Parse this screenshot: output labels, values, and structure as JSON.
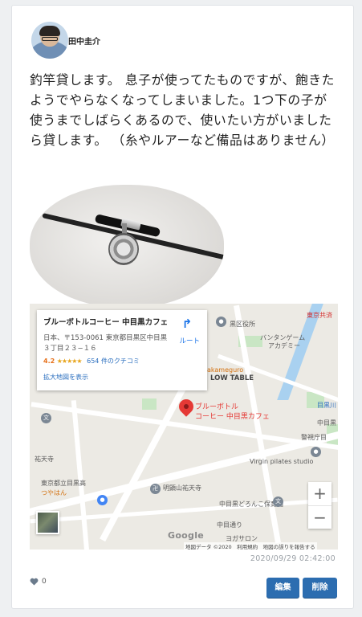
{
  "post": {
    "author": "田中圭介",
    "body": "釣竿貸します。 息子が使ってたものですが、飽きたようでやらなくなってしまいました。1つ下の子が使うまでしばらくあるので、使いたい方がいましたら貸します。 （糸やルアーなど備品はありません）",
    "timestamp": "2020/09/29 02:42:00",
    "likes": "0",
    "edit_label": "編集",
    "delete_label": "削除"
  },
  "map": {
    "place_name": "ブルーボトルコーヒー 中目黒カフェ",
    "address": "日本、〒153-0061 東京都目黒区中目黒３丁目２３−１６",
    "rating": "4.2",
    "stars": "★★★★★",
    "reviews": "654 件のクチコミ",
    "enlarge_link": "拡大地図を表示",
    "route_label": "ルート",
    "pin_label_line1": "ブルーボトル",
    "pin_label_line2": "コーヒー 中目黒カフェ",
    "labels": {
      "tokyo_kyosai": "東京共済",
      "ward_office": "黒区役所",
      "bantan_1": "バンタンゲーム",
      "bantan_2": "アカデミー",
      "akameguro": "akameguro",
      "low_table": "LOW TABLE",
      "meguro_river": "目黒川",
      "nakameguro": "中目黒",
      "police": "警視庁目",
      "yutenji": "祐天寺",
      "virgin": "Virgin pilates studio",
      "hs": "東京都立目黒高",
      "tsuyahan": "つやはん",
      "myokenzan": "明顕山祐天寺",
      "nursery": "中目黒どろんこ保育園",
      "nakameguro_st": "中目通り",
      "hotel": "ヨガサロン"
    },
    "google": "Google",
    "attribution": "地図データ ©2020　利用規約　地図の誤りを報告する",
    "zoom_in": "+",
    "zoom_out": "−",
    "route_icon": "↱"
  },
  "icons": {
    "heart": "heart-icon",
    "route": "directions-icon",
    "pin": "map-pin-icon"
  },
  "colors": {
    "button": "#2c6db0",
    "pin": "#e53935",
    "timestamp": "#9aa0a6"
  }
}
